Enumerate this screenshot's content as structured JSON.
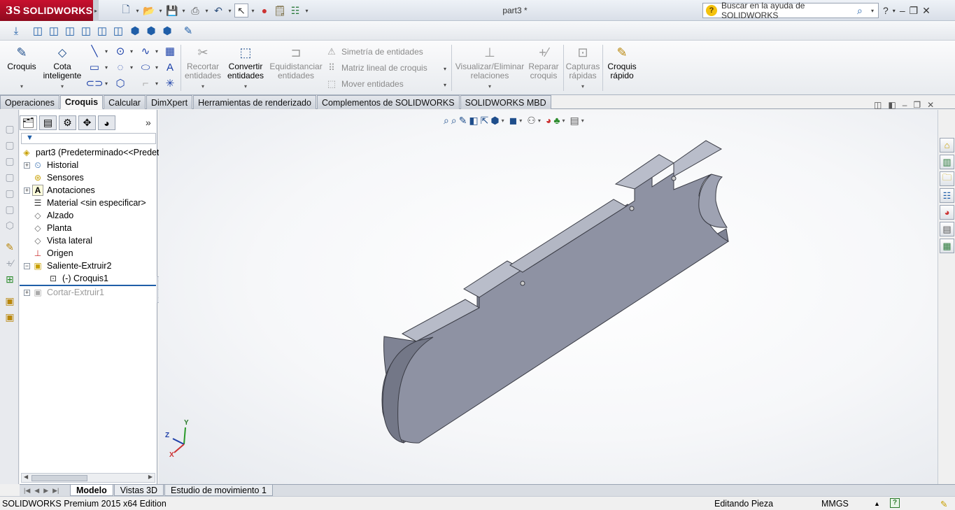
{
  "app": {
    "logo_text": "SOLIDWORKS",
    "logo_mark": "3S",
    "window_title": "part3 *"
  },
  "search": {
    "placeholder": "Buscar en la ayuda de SOLIDWORKS"
  },
  "ribbon": {
    "croquis": "Croquis",
    "cota_line1": "Cota",
    "cota_line2": "inteligente",
    "recortar_line1": "Recortar",
    "recortar_line2": "entidades",
    "convertir_line1": "Convertir",
    "convertir_line2": "entidades",
    "equidistanciar_line1": "Equidistanciar",
    "equidistanciar_line2": "entidades",
    "simetria": "Simetría de entidades",
    "matriz": "Matriz lineal de croquis",
    "mover": "Mover entidades",
    "visualizar_line1": "Visualizar/Eliminar",
    "visualizar_line2": "relaciones",
    "reparar_line1": "Reparar",
    "reparar_line2": "croquis",
    "capturas_line1": "Capturas",
    "capturas_line2": "rápidas",
    "croquis_rapido_line1": "Croquis",
    "croquis_rapido_line2": "rápido"
  },
  "tabs": [
    {
      "label": "Operaciones"
    },
    {
      "label": "Croquis"
    },
    {
      "label": "Calcular"
    },
    {
      "label": "DimXpert"
    },
    {
      "label": "Herramientas de renderizado"
    },
    {
      "label": "Complementos de SOLIDWORKS"
    },
    {
      "label": "SOLIDWORKS MBD"
    }
  ],
  "tree": {
    "root": "part3  (Predeterminado<<Predet",
    "items": [
      {
        "label": "Historial"
      },
      {
        "label": "Sensores"
      },
      {
        "label": "Anotaciones"
      },
      {
        "label": "Material <sin especificar>"
      },
      {
        "label": "Alzado"
      },
      {
        "label": "Planta"
      },
      {
        "label": "Vista lateral"
      },
      {
        "label": "Origen"
      },
      {
        "label": "Saliente-Extruir2"
      },
      {
        "label": "(-) Croquis1"
      },
      {
        "label": "Cortar-Extruir1"
      }
    ]
  },
  "triad": {
    "x": "X",
    "y": "Y",
    "z": "Z"
  },
  "bottom_tabs": [
    {
      "label": "Modelo"
    },
    {
      "label": "Vistas 3D"
    },
    {
      "label": "Estudio de movimiento 1"
    }
  ],
  "status": {
    "edition": "SOLIDWORKS Premium 2015 x64 Edition",
    "mode": "Editando Pieza",
    "units": "MMGS",
    "help": "?"
  },
  "colors": {
    "logo_red": "#c8102e",
    "part_face": "#8a8e9e",
    "part_side": "#a3a7b6",
    "part_top": "#b7bbc8"
  }
}
